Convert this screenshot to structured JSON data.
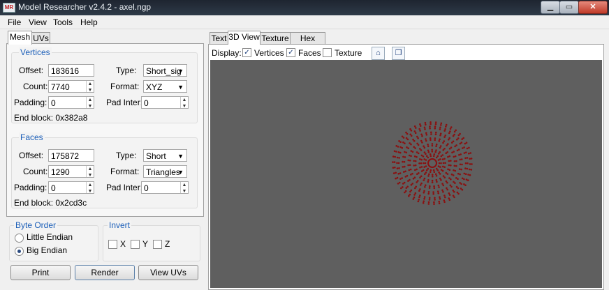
{
  "window": {
    "title": "Model Researcher v2.4.2 - axel.ngp",
    "icon_text": "MR",
    "icon": "app-icon",
    "min_glyph": "▁",
    "max_glyph": "▭",
    "close_glyph": "✕"
  },
  "menu": [
    "File",
    "View",
    "Tools",
    "Help"
  ],
  "left_tabs": [
    "Mesh",
    "UVs"
  ],
  "vertices": {
    "title": "Vertices",
    "offset_label": "Offset:",
    "offset_value": "183616",
    "count_label": "Count:",
    "count_value": "7740",
    "padding_label": "Padding:",
    "padding_value": "0",
    "type_label": "Type:",
    "type_value": "Short_sig",
    "format_label": "Format:",
    "format_value": "XYZ",
    "padinter_label": "Pad Inter:",
    "padinter_value": "0",
    "endblock": "End block: 0x382a8"
  },
  "faces": {
    "title": "Faces",
    "offset_label": "Offset:",
    "offset_value": "175872",
    "count_label": "Count:",
    "count_value": "1290",
    "padding_label": "Padding:",
    "padding_value": "0",
    "type_label": "Type:",
    "type_value": "Short",
    "format_label": "Format:",
    "format_value": "Triangles",
    "padinter_label": "Pad Inter:",
    "padinter_value": "0",
    "endblock": "End block: 0x2cd3c"
  },
  "byte_order": {
    "title": "Byte Order",
    "options": [
      "Little Endian",
      "Big Endian"
    ],
    "selected": "Big Endian"
  },
  "invert": {
    "title": "Invert",
    "x": "X",
    "y": "Y",
    "z": "Z"
  },
  "buttons": {
    "print": "Print",
    "render": "Render",
    "view_uvs": "View UVs"
  },
  "right_tabs": [
    "Text",
    "3D View",
    "Texture",
    "Hex View"
  ],
  "display": {
    "label": "Display:",
    "vertices": "Vertices",
    "vertices_checked": true,
    "faces": "Faces",
    "faces_checked": true,
    "texture": "Texture",
    "texture_checked": false,
    "home_icon": "home-icon",
    "view_icon": "cube-view-icon"
  },
  "viewport": {
    "background": "#5f5f5f",
    "point_color": "#8b1010"
  },
  "spinner": {
    "up": "▲",
    "down": "▼"
  },
  "combo_arrow": "▼",
  "check_glyph": "✓",
  "toolbar_glyphs": {
    "home": "⌂",
    "view": "❐"
  }
}
